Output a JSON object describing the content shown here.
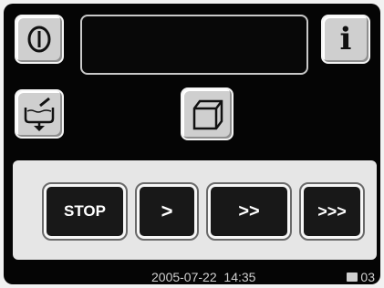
{
  "top_bar": {
    "power_icon": "power-icon",
    "info_label": "i",
    "info_icon": "info-icon",
    "display_text": ""
  },
  "second_row": {
    "basin_icon": "basin-drain-icon",
    "tray_icon": "tray-icon"
  },
  "speed_controls": [
    {
      "label": "STOP",
      "name": "stop-button"
    },
    {
      "label": ">",
      "name": "speed-1-button"
    },
    {
      "label": ">>",
      "name": "speed-2-button"
    },
    {
      "label": ">>>",
      "name": "speed-3-button"
    }
  ],
  "status_bar": {
    "date": "2005-07-22",
    "time": "14:35",
    "page_number": "03"
  },
  "colors": {
    "screen_bg": "#050505",
    "button_gray": "#cfcfcf",
    "speed_button_bg": "#181818",
    "panel_bg": "#e6e6e6"
  }
}
